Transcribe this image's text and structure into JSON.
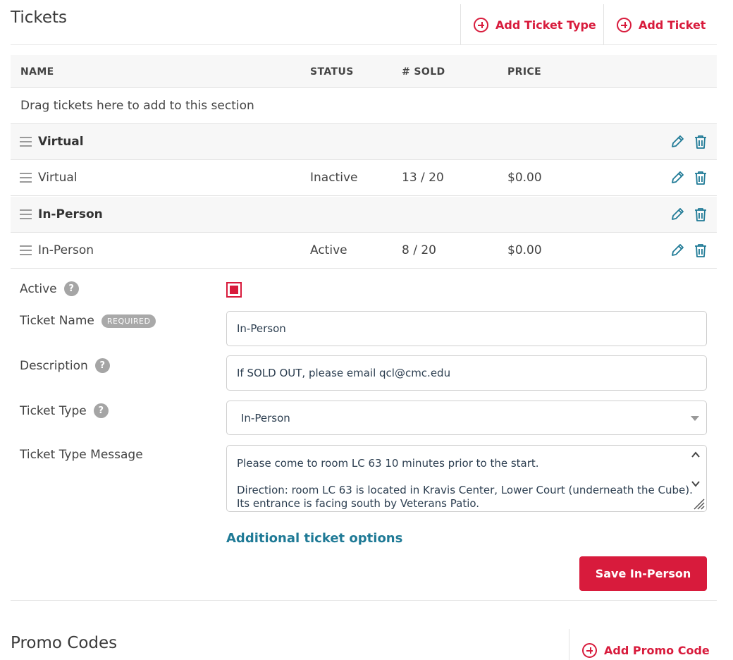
{
  "tickets": {
    "title": "Tickets",
    "add_ticket_type": "Add Ticket Type",
    "add_ticket": "Add Ticket",
    "columns": {
      "name": "NAME",
      "status": "STATUS",
      "sold": "# SOLD",
      "price": "PRICE"
    },
    "drop_hint": "Drag tickets here to add to this section",
    "rows": [
      {
        "kind": "group",
        "name": "Virtual"
      },
      {
        "kind": "ticket",
        "name": "Virtual",
        "status": "Inactive",
        "sold": "13 / 20",
        "price": "$0.00"
      },
      {
        "kind": "group",
        "name": "In-Person"
      },
      {
        "kind": "ticket",
        "name": "In-Person",
        "status": "Active",
        "sold": "8 / 20",
        "price": "$0.00"
      }
    ]
  },
  "form": {
    "active_label": "Active",
    "active_checked": true,
    "ticket_name_label": "Ticket Name",
    "required_badge": "REQUIRED",
    "ticket_name_value": "In-Person",
    "description_label": "Description",
    "description_value": "If SOLD OUT, please email qcl@cmc.edu",
    "ticket_type_label": "Ticket Type",
    "ticket_type_value": "In-Person",
    "ticket_type_message_label": "Ticket Type Message",
    "ticket_type_message_lines": [
      "Please come to room LC 63 10 minutes prior to the start.",
      "",
      "Direction: room LC 63 is located in Kravis Center, Lower Court (underneath the Cube).",
      "Its entrance is facing south by Veterans Patio."
    ],
    "additional_options": "Additional ticket options",
    "save_label": "Save In-Person",
    "help_glyph": "?"
  },
  "promo": {
    "title": "Promo Codes",
    "add_label": "Add Promo Code"
  },
  "colors": {
    "accent": "#d81b3c",
    "link": "#1f7a96",
    "icon": "#1f7a96"
  }
}
